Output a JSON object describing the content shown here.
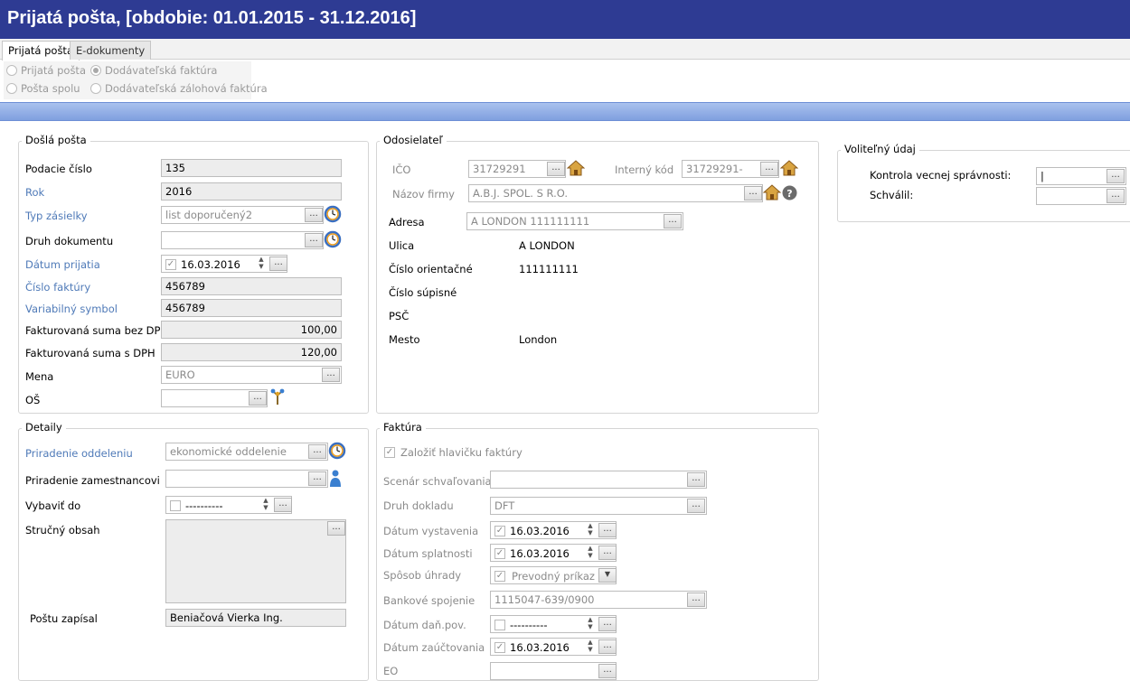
{
  "window": {
    "title": "Prijatá pošta, [obdobie: 01.01.2015 - 31.12.2016]"
  },
  "tabs": [
    {
      "label": "Prijatá pošta",
      "active": true
    },
    {
      "label": "E-dokumenty",
      "active": false
    }
  ],
  "radios": [
    {
      "label": "Prijatá pošta",
      "selected": false
    },
    {
      "label": "Dodávateľská faktúra",
      "selected": true
    },
    {
      "label": "Pošta spolu",
      "selected": false
    },
    {
      "label": "Dodávateľská zálohová faktúra",
      "selected": false
    }
  ],
  "button_glyph": "...",
  "dosla_posta": {
    "legend": "Došlá pošta",
    "podacie_cislo": {
      "label": "Podacie číslo",
      "value": "135"
    },
    "rok": {
      "label": "Rok",
      "value": "2016"
    },
    "typ_zasielky": {
      "label": "Typ zásielky",
      "value": "list doporučený2"
    },
    "druh_dokumentu": {
      "label": "Druh dokumentu",
      "value": ""
    },
    "datum_prijatia": {
      "label": "Dátum prijatia",
      "value": "16.03.2016"
    },
    "cislo_faktury": {
      "label": "Číslo faktúry",
      "value": "456789"
    },
    "variabilny_symbol": {
      "label": "Variabilný symbol",
      "value": "456789"
    },
    "suma_bez_dph": {
      "label": "Fakturovaná suma bez DPH",
      "value": "100,00"
    },
    "suma_s_dph": {
      "label": "Fakturovaná suma s DPH",
      "value": "120,00"
    },
    "mena": {
      "label": "Mena",
      "value": "EURO"
    },
    "os": {
      "label": "OŠ",
      "value": ""
    }
  },
  "odosielatel": {
    "legend": "Odosielateľ",
    "ico": {
      "label": "IČO",
      "value": "31729291"
    },
    "interny_kod": {
      "label": "Interný kód",
      "value": "31729291-"
    },
    "nazov_firmy": {
      "label": "Názov firmy",
      "value": "A.B.J. SPOL. S R.O."
    },
    "adresa": {
      "label": "Adresa",
      "value": "A  LONDON 111111111"
    },
    "ulica": {
      "label": "Ulica",
      "value": "A  LONDON"
    },
    "cislo_orientacne": {
      "label": "Číslo orientačné",
      "value": "111111111"
    },
    "cislo_supisne": {
      "label": "Číslo súpisné",
      "value": ""
    },
    "psc": {
      "label": "PSČ",
      "value": ""
    },
    "mesto": {
      "label": "Mesto",
      "value": "London"
    }
  },
  "volitelny": {
    "legend": "Voliteľný údaj",
    "kontrola": {
      "label": "Kontrola vecnej správnosti:",
      "value": "|"
    },
    "schvalil": {
      "label": "Schválil:",
      "value": ""
    }
  },
  "detaily": {
    "legend": "Detaily",
    "priradenie_oddeleniu": {
      "label": "Priradenie oddeleniu",
      "value": "ekonomické oddelenie"
    },
    "priradenie_zamestnancovi": {
      "label": "Priradenie zamestnancovi",
      "value": ""
    },
    "vybavit_do": {
      "label": "Vybaviť do",
      "value": "----------"
    },
    "strucny_obsah": {
      "label": "Stručný obsah",
      "value": ""
    },
    "postu_zapisal": {
      "label": "Poštu zapísal",
      "value": "Beniačová Vierka Ing."
    }
  },
  "faktura": {
    "legend": "Faktúra",
    "zalozit": {
      "label": "Založiť hlavičku faktúry",
      "checked": true
    },
    "scenar": {
      "label": "Scenár schvaľovania",
      "value": ""
    },
    "druh_dokladu": {
      "label": "Druh dokladu",
      "value": "DFT"
    },
    "datum_vystavenia": {
      "label": "Dátum vystavenia",
      "value": "16.03.2016"
    },
    "datum_splatnosti": {
      "label": "Dátum splatnosti",
      "value": "16.03.2016"
    },
    "sposob_uhrady": {
      "label": "Spôsob úhrady",
      "value": "Prevodný príkaz"
    },
    "bankove_spojenie": {
      "label": "Bankové spojenie",
      "value": "1115047-639/0900"
    },
    "datum_dan_pov": {
      "label": "Dátum daň.pov.",
      "value": "----------"
    },
    "datum_zauctovania": {
      "label": "Dátum zaúčtovania",
      "value": "16.03.2016"
    },
    "eo": {
      "label": "EO",
      "value": ""
    }
  },
  "colors": {
    "title_bg": "#2e3b93",
    "accent_blue": "#4f7ab8",
    "bar_blue": "#7f9fdf"
  }
}
